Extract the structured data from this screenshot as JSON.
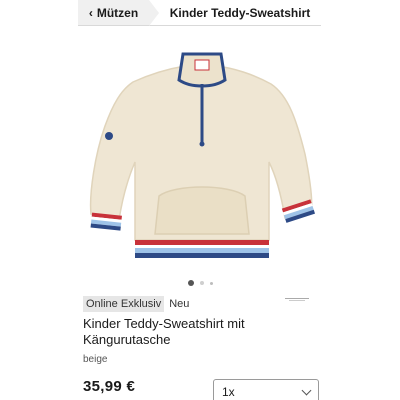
{
  "nav": {
    "back_label": "Mützen",
    "back_chevron": "‹",
    "current_label": "Kinder Teddy-Sweatshirt"
  },
  "product": {
    "image_icon": "sweatshirt-product-image",
    "colors": {
      "fleece": "#efe6d3",
      "fleece_shadow": "#e0d4bb",
      "stripe_navy": "#2d4a86",
      "stripe_red": "#c8323a",
      "stripe_light_blue": "#9ec3e8",
      "stripe_white": "#ffffff"
    },
    "gallery": {
      "count": 3,
      "active_index": 0
    },
    "badges": {
      "exclusive": "Online Exklusiv",
      "new": "Neu"
    },
    "brand_logo_icon": "brand-logo",
    "title": "Kinder Teddy-Sweatshirt mit Kängurutasche",
    "color_name": "beige",
    "price": "35,99 €",
    "quantity": {
      "selected": "1x"
    }
  }
}
